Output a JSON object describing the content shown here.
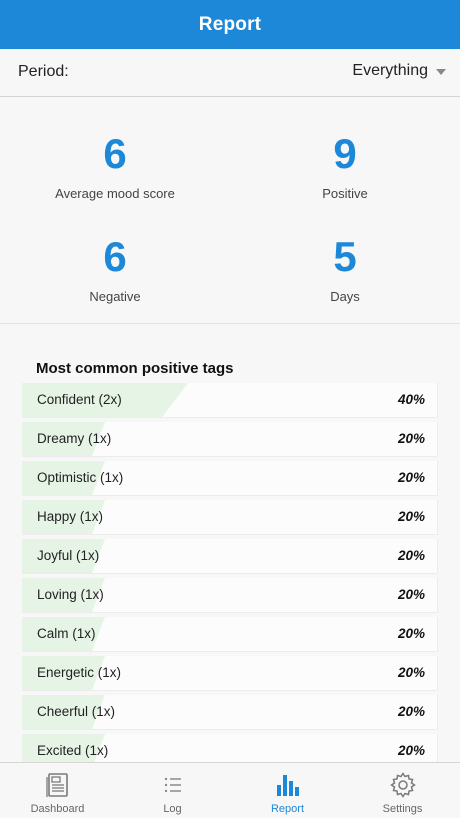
{
  "header": {
    "title": "Report"
  },
  "period": {
    "label": "Period:",
    "value": "Everything"
  },
  "stats": [
    {
      "value": "6",
      "label": "Average mood score"
    },
    {
      "value": "9",
      "label": "Positive"
    },
    {
      "value": "6",
      "label": "Negative"
    },
    {
      "value": "5",
      "label": "Days"
    }
  ],
  "tags": {
    "title": "Most common positive tags",
    "items": [
      {
        "name": "Confident (2x)",
        "percent": "40%",
        "fraction": 0.4
      },
      {
        "name": "Dreamy (1x)",
        "percent": "20%",
        "fraction": 0.2
      },
      {
        "name": "Optimistic (1x)",
        "percent": "20%",
        "fraction": 0.2
      },
      {
        "name": "Happy (1x)",
        "percent": "20%",
        "fraction": 0.2
      },
      {
        "name": "Joyful (1x)",
        "percent": "20%",
        "fraction": 0.2
      },
      {
        "name": "Loving (1x)",
        "percent": "20%",
        "fraction": 0.2
      },
      {
        "name": "Calm (1x)",
        "percent": "20%",
        "fraction": 0.2
      },
      {
        "name": "Energetic (1x)",
        "percent": "20%",
        "fraction": 0.2
      },
      {
        "name": "Cheerful (1x)",
        "percent": "20%",
        "fraction": 0.2
      },
      {
        "name": "Excited (1x)",
        "percent": "20%",
        "fraction": 0.2
      }
    ]
  },
  "nav": {
    "items": [
      {
        "label": "Dashboard",
        "icon": "dashboard-icon",
        "active": false
      },
      {
        "label": "Log",
        "icon": "list-icon",
        "active": false
      },
      {
        "label": "Report",
        "icon": "bar-chart-icon",
        "active": true
      },
      {
        "label": "Settings",
        "icon": "gear-icon",
        "active": false
      }
    ]
  },
  "colors": {
    "accent": "#1e88d8",
    "tag_fill": "#e6f4e6"
  }
}
